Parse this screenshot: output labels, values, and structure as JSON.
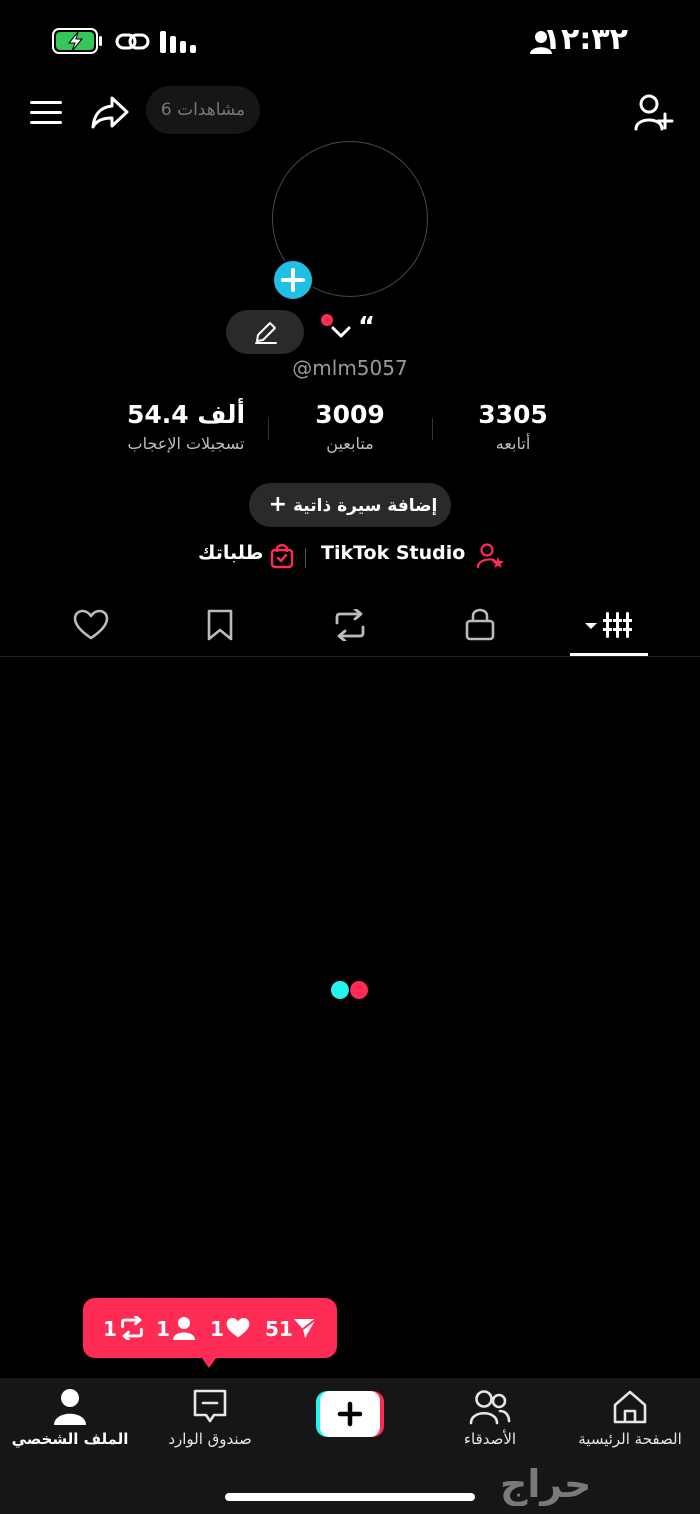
{
  "status_bar": {
    "time": "١٢:٣٢"
  },
  "top_bar": {
    "views": "6 مشاهدات"
  },
  "profile": {
    "name": "“",
    "handle": "@mlm5057",
    "stats": [
      {
        "value": "3305",
        "label": "أتابعه"
      },
      {
        "value": "3009",
        "label": "متابعين"
      },
      {
        "value": "54.4 ألف",
        "label": "تسجيلات الإعجاب"
      }
    ],
    "add_bio": "إضافة سيرة ذاتية",
    "studio_link": "TikTok Studio",
    "orders_link": "طلباتك"
  },
  "notification": {
    "shares": "51",
    "likes": "1",
    "followers": "1",
    "reposts": "1"
  },
  "bottom_nav": {
    "home": "الصفحة الرئيسية",
    "friends": "الأصدقاء",
    "inbox": "صندوق الوارد",
    "profile": "الملف الشخصي"
  },
  "watermark": "حراج",
  "colors": {
    "accent": "#fe2c55",
    "cyan": "#25f4ee",
    "plus_blue": "#20bfe6"
  }
}
